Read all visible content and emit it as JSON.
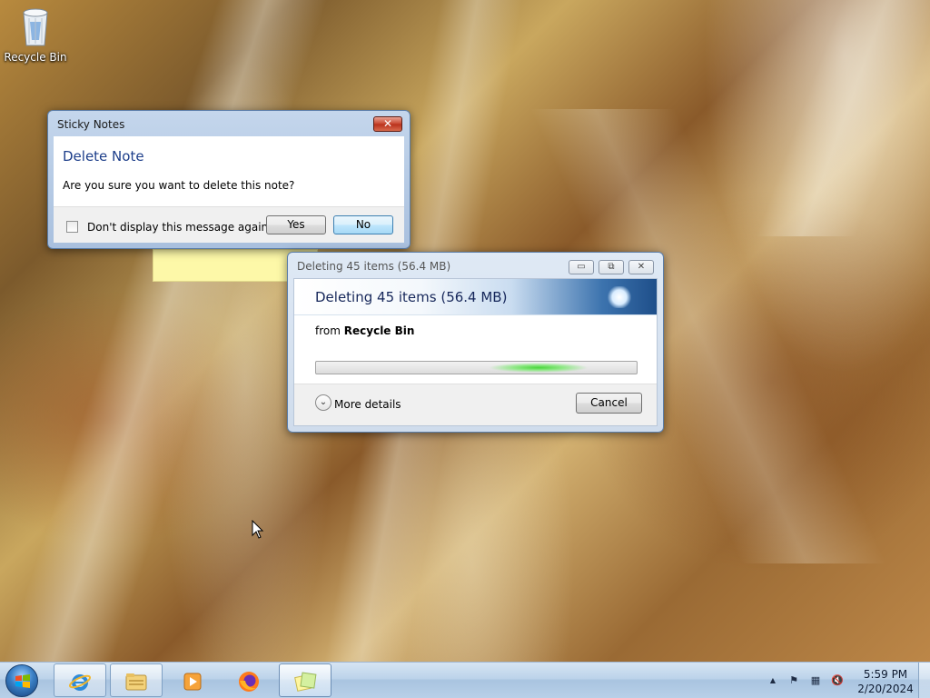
{
  "desktop": {
    "recycle_bin_label": "Recycle Bin"
  },
  "sticky_dialog": {
    "title": "Sticky Notes",
    "close_glyph": "✕",
    "heading": "Delete Note",
    "message": "Are you sure you want to delete this note?",
    "checkbox_label": "Don't display this message again",
    "yes_label": "Yes",
    "no_label": "No"
  },
  "delete_dialog": {
    "title": "Deleting 45 items (56.4 MB)",
    "banner_text": "Deleting 45 items (56.4 MB)",
    "from_prefix": "from",
    "from_location": "Recycle Bin",
    "more_details_label": "More details",
    "cancel_label": "Cancel",
    "minimize_glyph": "▭",
    "maximize_glyph": "⧉",
    "close_glyph": "✕"
  },
  "taskbar": {
    "start_icon": "windows-logo",
    "pinned": [
      {
        "name": "internet-explorer",
        "glyph": "e"
      },
      {
        "name": "windows-explorer",
        "glyph": "▤"
      },
      {
        "name": "media-player",
        "glyph": "▶"
      },
      {
        "name": "firefox",
        "glyph": "●"
      },
      {
        "name": "sticky-notes",
        "glyph": "■"
      }
    ],
    "tray": {
      "up_arrow": "▲",
      "flag": "⚑",
      "network": "▦",
      "volume": "🔇"
    },
    "time": "5:59 PM",
    "date": "2/20/2024"
  },
  "colors": {
    "accent_title_blue": "#1d3e8a",
    "progress_green": "#48d63a",
    "close_red": "#c7442c"
  }
}
